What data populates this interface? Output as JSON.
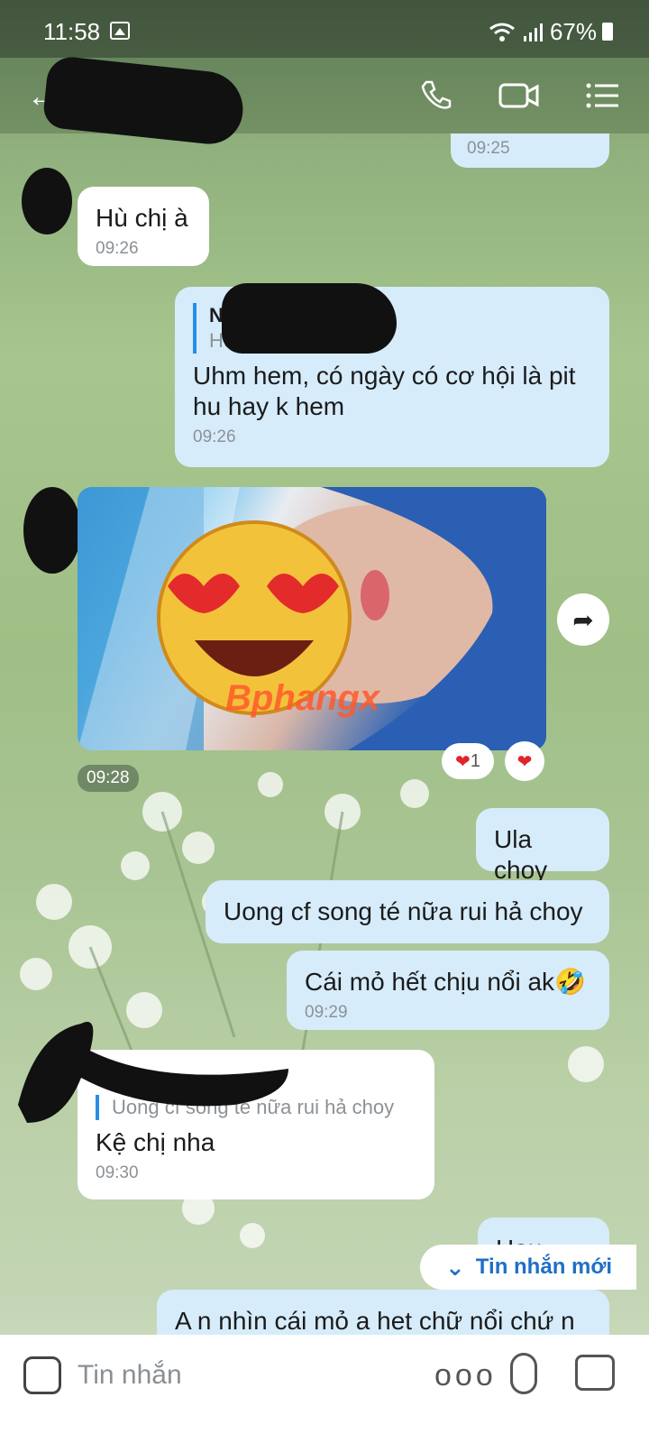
{
  "status": {
    "time": "11:58",
    "battery": "67%"
  },
  "header": {
    "icons": [
      "back-arrow-icon",
      "phone-icon",
      "video-icon",
      "menu-list-icon"
    ]
  },
  "messages": [
    {
      "dir": "out",
      "time": "09:25"
    },
    {
      "dir": "in",
      "text": "Hù chị à",
      "time": "09:26"
    },
    {
      "dir": "out",
      "quote_name": "N",
      "quote_text": "Hù chị à",
      "text": "Uhm hem, có ngày có cơ hội là pit hu hay k hem",
      "time": "09:26"
    },
    {
      "dir": "in",
      "type": "image",
      "watermark": "Bphangx",
      "time": "09:28",
      "reaction_count": "1"
    },
    {
      "dir": "out",
      "text": "Ula choy"
    },
    {
      "dir": "out",
      "text": "Uong cf song té nữa rui hả choy"
    },
    {
      "dir": "out",
      "text": "Cái mỏ hết chịu nổi ak🤣",
      "time": "09:29"
    },
    {
      "dir": "in",
      "quote_text": "Uong cf song té nữa rui hả choy",
      "text": "Kệ chị nha",
      "time": "09:30"
    },
    {
      "dir": "out",
      "text": "Hau"
    },
    {
      "dir": "out",
      "text": "A n nhìn cái mỏ a het chữ nổi chứ n"
    }
  ],
  "new_message_label": "Tin nhắn mới",
  "composer": {
    "placeholder": "Tin nhắn",
    "more": "ooo"
  },
  "colors": {
    "outgoing": "#d6ecfb",
    "incoming": "#ffffff",
    "accent": "#1f6fc7"
  }
}
